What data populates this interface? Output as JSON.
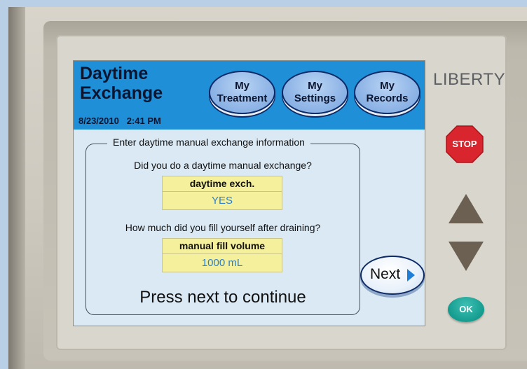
{
  "screen": {
    "title_line1": "Daytime",
    "title_line2": "Exchange",
    "date": "8/23/2010",
    "time": "2:41 PM",
    "tabs": [
      {
        "line1": "My",
        "line2": "Treatment"
      },
      {
        "line1": "My",
        "line2": "Settings"
      },
      {
        "line1": "My",
        "line2": "Records"
      }
    ],
    "panel": {
      "legend": "Enter daytime manual exchange information",
      "question1": "Did you do a daytime manual exchange?",
      "field1": {
        "label": "daytime exch.",
        "value": "YES"
      },
      "question2": "How much did you fill yourself after draining?",
      "field2": {
        "label": "manual fill volume",
        "value": "1000 mL"
      },
      "footer": "Press next to continue"
    },
    "next_label": "Next"
  },
  "device": {
    "brand": "LIBERTY",
    "stop_label": "STOP",
    "ok_label": "OK"
  },
  "colors": {
    "header_blue": "#1f8fd8",
    "screen_bg": "#dbe9f4",
    "field_yellow": "#f5f09c",
    "value_blue": "#2b7fcf",
    "stop_red": "#d9262e",
    "arrow_brown": "#6b6052",
    "ok_teal": "#149c8f"
  },
  "icons": {
    "next": "right-triangle-icon",
    "up": "up-arrow-icon",
    "down": "down-arrow-icon",
    "stop": "octagon-stop-icon"
  }
}
